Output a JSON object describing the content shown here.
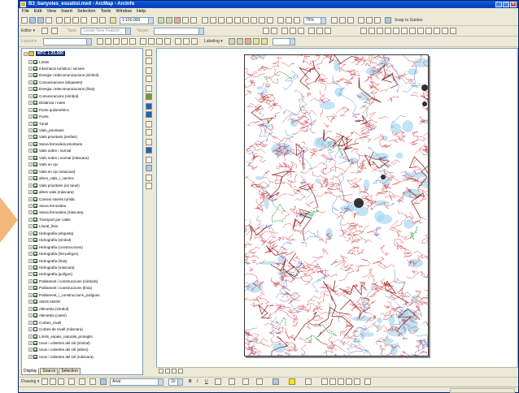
{
  "window": {
    "title": "B3_banyoles_essattol.mxd - ArcMap - ArcInfo",
    "colors": {
      "titlebar": "#0a46c7",
      "chrome": "#ece9d8",
      "selection": "#0a246a"
    }
  },
  "menu": [
    "File",
    "Edit",
    "View",
    "Insert",
    "Selection",
    "Tools",
    "Window",
    "Help"
  ],
  "toolbar": {
    "scale_value": "1:150.000",
    "zoom_to_guides": "Snap to Guides",
    "editor_label": "Editor ▾",
    "task_label": "Task:",
    "task_value": "Create New Feature",
    "target_label": "Target:",
    "layout_label": "Layout ▾",
    "zoom_percent": "75%",
    "labeling_label": "Labeling ▾"
  },
  "toc": {
    "root": "MTC 1:25.000",
    "layers": [
      {
        "name": "Límits",
        "checked": true
      },
      {
        "name": "Informació turística i serveis",
        "checked": true
      },
      {
        "name": "Energia i telecomunicacions (símbol)",
        "checked": true
      },
      {
        "name": "Comunicacions (etiquetes)",
        "checked": true
      },
      {
        "name": "Energia i telecomunicacions (línia)",
        "checked": true
      },
      {
        "name": "Comunicacions (símbol)",
        "checked": true
      },
      {
        "name": "Distància i rutes",
        "checked": true
      },
      {
        "name": "Punts quilomètrics",
        "checked": true
      },
      {
        "name": "Ponts",
        "checked": true
      },
      {
        "name": "Túnel",
        "checked": true
      },
      {
        "name": "Vials_prioritaris",
        "checked": true
      },
      {
        "name": "Vials prioritaris (emfasi)",
        "checked": true
      },
      {
        "name": "Xarxa ferroviària prioritaria",
        "checked": true
      },
      {
        "name": "Vials sobre i normal",
        "checked": true
      },
      {
        "name": "Vials sobre i normal (màscara)",
        "checked": true
      },
      {
        "name": "Vials en cip",
        "checked": true
      },
      {
        "name": "Vials en cip (màscara)",
        "checked": true
      },
      {
        "name": "altres_vials_i_camins",
        "checked": true
      },
      {
        "name": "Vials prioritaris (en túnel)",
        "checked": true
      },
      {
        "name": "altres vials (màscara)",
        "checked": true
      },
      {
        "name": "Camins interès turístic",
        "checked": true
      },
      {
        "name": "Xarxa ferroviària",
        "checked": true
      },
      {
        "name": "Xarxa ferroviària (màscara)",
        "checked": true
      },
      {
        "name": "Transport per cable",
        "checked": true
      },
      {
        "name": "Litoral_línia",
        "checked": true
      },
      {
        "name": "Hidrografia (etiqueta)",
        "checked": true
      },
      {
        "name": "Hidrografia (símbol)",
        "checked": true
      },
      {
        "name": "Hidrografia (construccions)",
        "checked": true
      },
      {
        "name": "Hidrografia (línt-polígon)",
        "checked": true
      },
      {
        "name": "Hidrografia (línia)",
        "checked": true
      },
      {
        "name": "Hidrografia (màscara)",
        "checked": true
      },
      {
        "name": "Hidrografia (polígon)",
        "checked": true
      },
      {
        "name": "Poblament i construccions (símbols)",
        "checked": true
      },
      {
        "name": "Poblament i construccions (línia)",
        "checked": true
      },
      {
        "name": "Poblament_i_construccions_polígons",
        "checked": true
      },
      {
        "name": "ADOCADOR",
        "checked": true
      },
      {
        "name": "Altimetria (símbol)",
        "checked": true
      },
      {
        "name": "Altimetria (cotes)",
        "checked": true
      },
      {
        "name": "Corbes_nivell",
        "checked": false
      },
      {
        "name": "Corbes de nivell (màscara)",
        "checked": false
      },
      {
        "name": "Límits_espais_naturals_protegits",
        "checked": true
      },
      {
        "name": "Usos i cobertes del sòl (símbol)",
        "checked": true
      },
      {
        "name": "Usos i cobertes del sòl (altres)",
        "checked": true
      },
      {
        "name": "Usos i cobertes del sòl (màscara)",
        "checked": true
      }
    ],
    "tabs": [
      "Display",
      "Source",
      "Selection"
    ]
  },
  "drawing_toolbar": {
    "drawing_label": "Drawing ▾",
    "font_name": "Arial",
    "font_size": "10",
    "bold": "B",
    "italic": "I",
    "underline": "U"
  },
  "map": {
    "colors": {
      "contours": "#c8323c",
      "hydro": "#2e6fd0",
      "roads": "#8a1a1a",
      "water": "#a8d8f0",
      "forest": "#2a9a3a"
    }
  }
}
